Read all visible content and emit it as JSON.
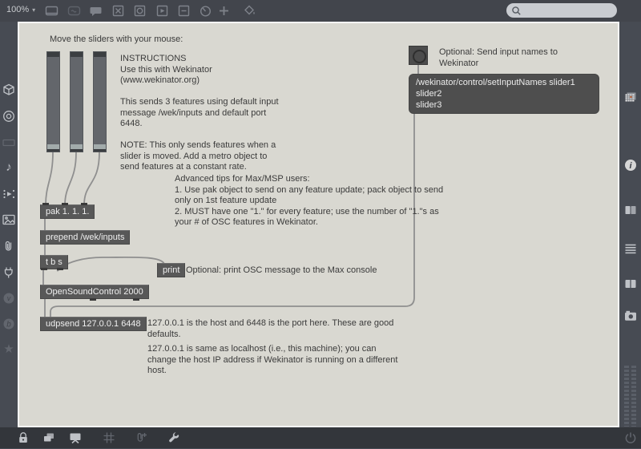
{
  "topbar": {
    "zoom_label": "100%",
    "zoom_caret": "▾",
    "tools": [
      {
        "name": "new-object-tool"
      },
      {
        "name": "new-message-tool"
      },
      {
        "name": "new-comment-tool"
      },
      {
        "name": "new-toggle-tool"
      },
      {
        "name": "new-button-tool"
      },
      {
        "name": "new-playbar-tool"
      },
      {
        "name": "new-number-box-tool"
      },
      {
        "name": "new-dial-tool"
      },
      {
        "name": "add-object-tool"
      },
      {
        "name": "paint-mode-tool"
      }
    ],
    "search": {
      "placeholder": ""
    }
  },
  "left_sidebar": {
    "items": [
      "cube-icon",
      "target-icon",
      "rectangle-icon",
      "music-note-icon",
      "playlist-icon",
      "image-icon",
      "paperclip-icon",
      "plug-icon",
      "v-badge-icon",
      "b-badge-icon",
      "star-icon"
    ]
  },
  "right_sidebar": {
    "items": [
      "grid-palette-icon",
      "info-icon",
      "sidebar-pages-icon",
      "list-icon",
      "book-icon",
      "camera-icon",
      "level-meters",
      "power-icon"
    ]
  },
  "bottom_bar": {
    "items": [
      "lock-icon",
      "layers-icon",
      "presentation-icon",
      "grid-icon",
      "paperclip-plus-icon",
      "wrench-icon"
    ]
  },
  "glyphs": {
    "music_note": "♪",
    "star": "★",
    "v": "v",
    "b": "b",
    "i": "i"
  },
  "canvas": {
    "comments": {
      "move": "Move the sliders with your mouse:",
      "instructions": "INSTRUCTIONS\nUse this with Wekinator\n(www.wekinator.org)\n\nThis sends 3 features using default input\nmessage /wek/inputs and default port\n6448.\n\nNOTE: This only sends features when a\nslider is moved. Add a metro object to\nsend features at a constant rate.",
      "advanced": "Advanced tips for Max/MSP users:\n1. Use pak object to send on any feature update; pack object to send\nonly on 1st feature update\n2. MUST have one \"1.\" for every feature; use the number of \"1.\"s as\nyour # of OSC features in Wekinator.",
      "print_note": "Optional: print OSC message to the Max console",
      "send_names": "Optional: Send input names to\nWekinator",
      "udp_note1": "127.0.0.1 is the host and 6448 is the port here. These are good\ndefaults.",
      "udp_note2": "127.0.0.1 is same as localhost (i.e., this machine); you can\nchange the host IP address if Wekinator is running on a different\nhost."
    },
    "objects": {
      "pak": "pak 1. 1. 1.",
      "prepend": "prepend /wek/inputs",
      "tbs": "t b s",
      "print": "print",
      "osc": "OpenSoundControl 2000",
      "udpsend": "udpsend 127.0.0.1 6448",
      "message": "/wekinator/control/setInputNames slider1 slider2\nslider3"
    },
    "slider_count": 3
  },
  "colors": {
    "canvas_bg": "#d9d8d1",
    "toolbar_bg": "#42454c",
    "sidebar_bg": "#474b53",
    "bottombar_bg": "#33363b",
    "object_bg": "#585858",
    "message_bg": "#4e4e4e",
    "patch_cord": "#8f8f8f",
    "slider_knob": "#a2abab",
    "palette_accent": "#c06b45"
  }
}
